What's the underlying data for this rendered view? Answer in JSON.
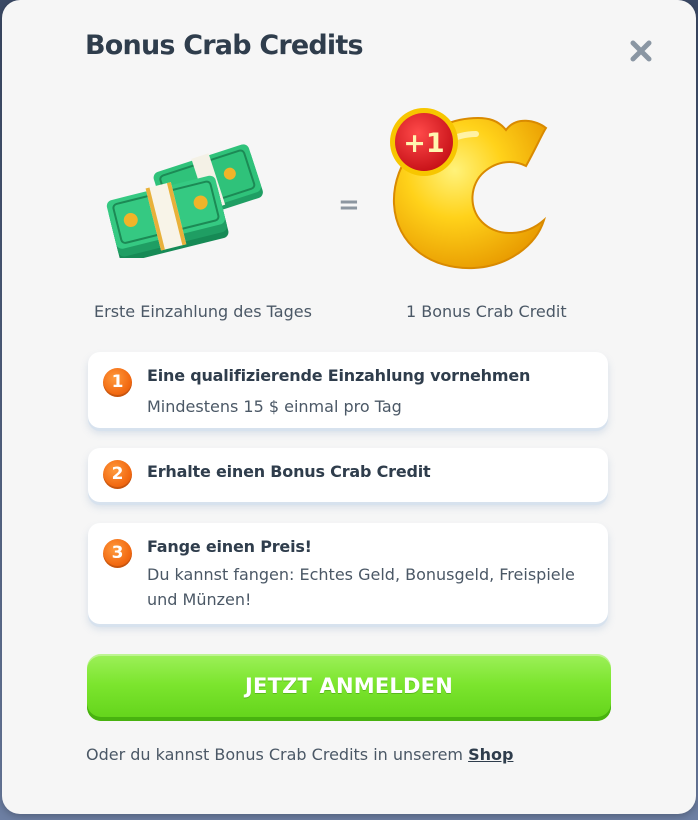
{
  "modal": {
    "title": "Bonus Crab Credits",
    "close_icon": "close-icon"
  },
  "illustration": {
    "left_icon": "cash-stack-icon",
    "equals_sign": "=",
    "right_icon": "crab-credit-coin-icon",
    "badge_text": "+1",
    "left_caption": "Erste Einzahlung des Tages",
    "right_caption": "1 Bonus Crab Credit"
  },
  "steps": [
    {
      "number": "1",
      "title": "Eine qualifizierende Einzahlung vornehmen",
      "description": "Mindestens 15 $ einmal pro Tag"
    },
    {
      "number": "2",
      "title": "Erhalte einen Bonus Crab Credit",
      "description": ""
    },
    {
      "number": "3",
      "title": "Fange einen Preis!",
      "description": "Du kannst fangen: Echtes Geld, Bonusgeld, Freispiele und Münzen!"
    }
  ],
  "cta": {
    "label": "JETZT ANMELDEN"
  },
  "footer": {
    "text": "Oder du kannst Bonus Crab Credits in unserem ",
    "link_label": "Shop"
  },
  "colors": {
    "title": "#2f3d4c",
    "cta_green": "#7ce52e",
    "step_badge_orange": "#f26a12",
    "badge_red": "#e0161e",
    "coin_yellow": "#ffd21a"
  }
}
